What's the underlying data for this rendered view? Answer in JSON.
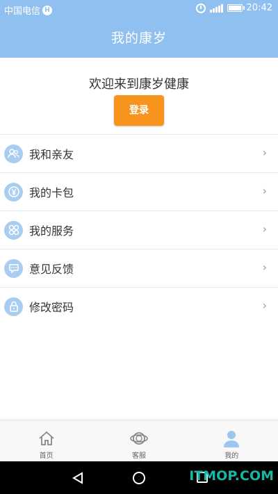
{
  "status_bar": {
    "carrier": "中国电信",
    "hd_badge": "H",
    "time": "20:42",
    "icons": [
      "alarm-icon",
      "signal-icon",
      "battery-icon"
    ]
  },
  "header": {
    "title": "我的康岁"
  },
  "welcome": {
    "text": "欢迎来到康岁健康",
    "login_label": "登录"
  },
  "menu": {
    "items": [
      {
        "label": "我和亲友",
        "icon": "friends-icon"
      },
      {
        "label": "我的卡包",
        "icon": "yen-card-icon"
      },
      {
        "label": "我的服务",
        "icon": "service-icon"
      },
      {
        "label": "意见反馈",
        "icon": "feedback-icon"
      },
      {
        "label": "修改密码",
        "icon": "lock-icon"
      }
    ],
    "arrow": "›"
  },
  "tabs": [
    {
      "label": "首页",
      "icon": "home-icon"
    },
    {
      "label": "客服",
      "icon": "headset-icon"
    },
    {
      "label": "我的",
      "icon": "user-icon"
    }
  ],
  "watermark": "ITMOP.COM",
  "colors": {
    "header": "#8fc0ef",
    "login_button": "#f7941d",
    "menu_icon": "#a9cdf0"
  }
}
